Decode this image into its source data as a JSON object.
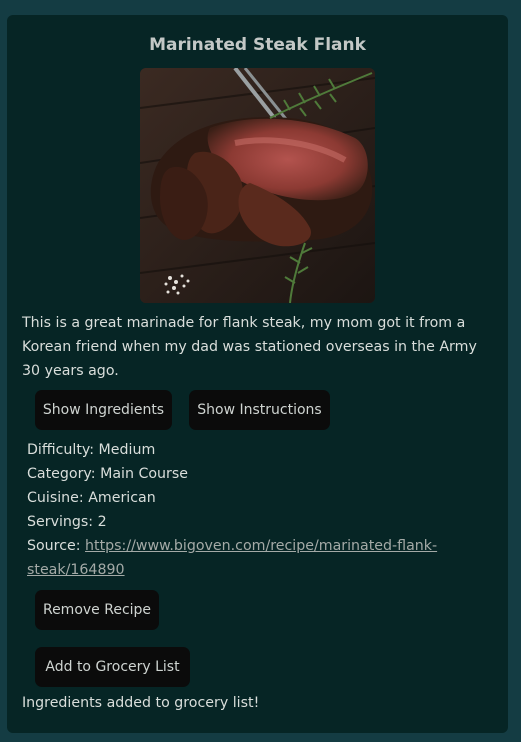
{
  "recipe": {
    "title": "Marinated Steak Flank",
    "image_alt": "Sliced grilled flank steak with rosemary",
    "description": "This is a great marinade for flank steak, my mom got it from a Korean friend when my dad was stationed overseas in the Army 30 years ago.",
    "difficulty_label": "Difficulty:",
    "difficulty": "Medium",
    "category_label": "Category:",
    "category": "Main Course",
    "cuisine_label": "Cuisine:",
    "cuisine": "American",
    "servings_label": "Servings:",
    "servings": "2",
    "source_label": "Source:",
    "source_url": "https://www.bigoven.com/recipe/marinated-flank-steak/164890"
  },
  "actions": {
    "show_ingredients": "Show Ingredients",
    "show_instructions": "Show Instructions",
    "remove_recipe": "Remove Recipe",
    "add_to_grocery": "Add to Grocery List"
  },
  "status": {
    "message": "Ingredients added to grocery list!"
  }
}
